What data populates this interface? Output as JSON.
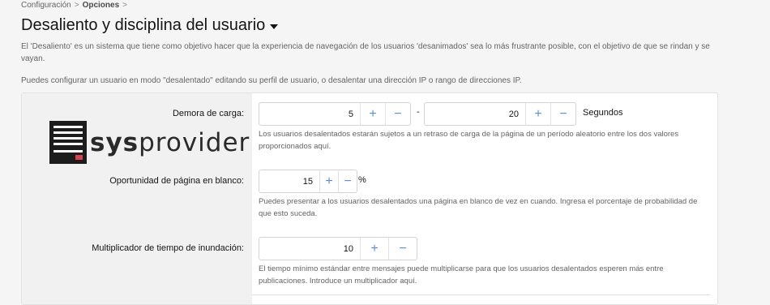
{
  "breadcrumb": {
    "items": [
      "Configuración",
      "Opciones"
    ],
    "separator": ">"
  },
  "page": {
    "title": "Desaliento y disciplina del usuario",
    "description1": "El 'Desaliento' es un sistema que tiene como objetivo hacer que la experiencia de navegación de los usuarios 'desanimados' sea lo más frustrante posible, con el objetivo de que se rindan y se vayan.",
    "description2": "Puedes configurar un usuario en modo \"desalentado\" editando su perfil de usuario, o desalentar una dirección IP o rango de direcciones IP."
  },
  "logo": {
    "prefix": "sys",
    "suffix": "provider",
    "icon": "server-logo-icon"
  },
  "fields": {
    "load_delay": {
      "label": "Demora de carga:",
      "min_value": "5",
      "separator": "-",
      "max_value": "20",
      "unit": "Segundos",
      "help": "Los usuarios desalentados estarán sujetos a un retraso de carga de la página de un período aleatorio entre los dos valores proporcionados aquí."
    },
    "blank_page": {
      "label": "Oportunidad de página en blanco:",
      "value": "15",
      "unit": "%",
      "help": "Puedes presentar a los usuarios desalentados una página en blanco de vez en cuando. Ingresa el porcentaje de probabilidad de que esto suceda."
    },
    "flood_multiplier": {
      "label": "Multiplicador de tiempo de inundación:",
      "value": "10",
      "help": "El tiempo mínimo estándar entre mensajes puede multiplicarse para que los usuarios desalentados esperen más entre publicaciones. Introduce un multiplicador aquí."
    }
  },
  "buttons": {
    "increment": "+",
    "decrement": "−"
  },
  "colors": {
    "accent": "#5b8fd0",
    "background": "#f5f5f5",
    "panel_left": "#f1f1f1"
  }
}
